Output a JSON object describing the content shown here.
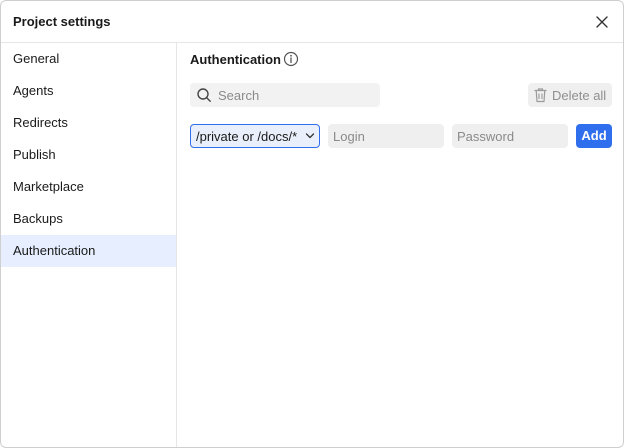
{
  "dialog": {
    "title": "Project settings"
  },
  "sidebar": {
    "items": [
      {
        "label": "General"
      },
      {
        "label": "Agents"
      },
      {
        "label": "Redirects"
      },
      {
        "label": "Publish"
      },
      {
        "label": "Marketplace"
      },
      {
        "label": "Backups"
      },
      {
        "label": "Authentication",
        "active": true
      }
    ]
  },
  "main": {
    "section_title": "Authentication",
    "search": {
      "placeholder": "Search",
      "value": ""
    },
    "delete_all_label": "Delete all",
    "path_select": {
      "value": "/private or /docs/*"
    },
    "login": {
      "placeholder": "Login",
      "value": ""
    },
    "password": {
      "placeholder": "Password",
      "value": ""
    },
    "add_label": "Add"
  },
  "icons": {
    "close": "close-icon",
    "info": "info-icon",
    "search": "search-icon",
    "trash": "trash-icon",
    "chevron": "chevron-down-icon"
  },
  "colors": {
    "accent": "#2f6fed",
    "active_bg": "#e6eeff",
    "disabled_text": "#8f8f8f"
  }
}
